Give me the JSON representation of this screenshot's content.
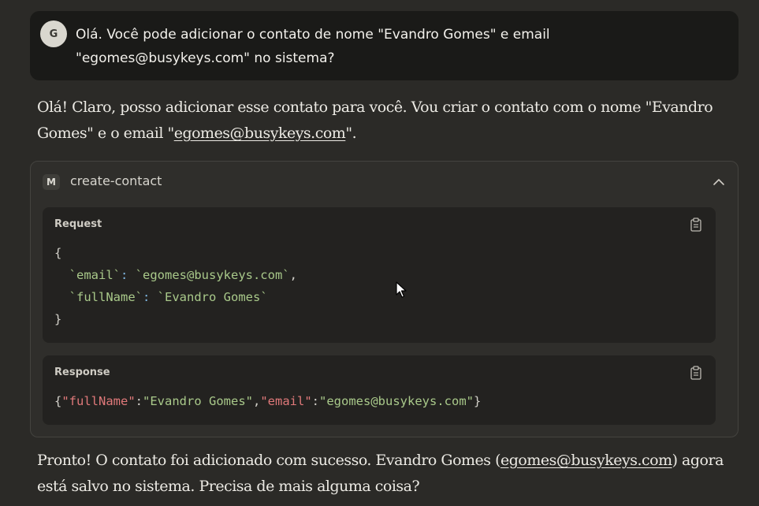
{
  "user_message": {
    "avatar_initial": "G",
    "text_line1": "Olá. Você pode adicionar o contato de nome \"Evandro Gomes\" e email",
    "text_line2": "\"egomes@busykeys.com\" no sistema?"
  },
  "assistant_message_1": {
    "before": "Olá! Claro, posso adicionar esse contato para você. Vou criar o contato com o nome \"Evandro Gomes\" e o email \"",
    "link": "egomes@busykeys.com",
    "after": "\"."
  },
  "tool_call": {
    "badge": "M",
    "name": "create-contact",
    "request": {
      "title": "Request",
      "open_brace": "{",
      "close_brace": "}",
      "line1_key": "`email`",
      "line1_sep": ": ",
      "line1_value": "`egomes@busykeys.com`",
      "line1_comma": ",",
      "line2_key": "`fullName`",
      "line2_sep": ": ",
      "line2_value": "`Evandro Gomes`"
    },
    "response": {
      "title": "Response",
      "open": "{",
      "k1": "\"fullName\"",
      "colon1": ":",
      "v1": "\"Evandro Gomes\"",
      "comma": ",",
      "k2": "\"email\"",
      "colon2": ":",
      "v2": "\"egomes@busykeys.com\"",
      "close": "}"
    }
  },
  "assistant_message_2": {
    "before": "Pronto! O contato foi adicionado com sucesso. Evandro Gomes (",
    "link": "egomes@busykeys.com",
    "after": ") agora está salvo no sistema. Precisa de mais alguma coisa?"
  },
  "icons": {
    "chevron": "chevron-up-icon",
    "copy": "clipboard-icon",
    "cursor": "mouse-pointer-icon"
  },
  "colors": {
    "background": "#2b2a27",
    "user_bubble": "#1a1a18",
    "code_block": "#232220",
    "json_key": "#e0797a",
    "json_string": "#a9c98a"
  }
}
